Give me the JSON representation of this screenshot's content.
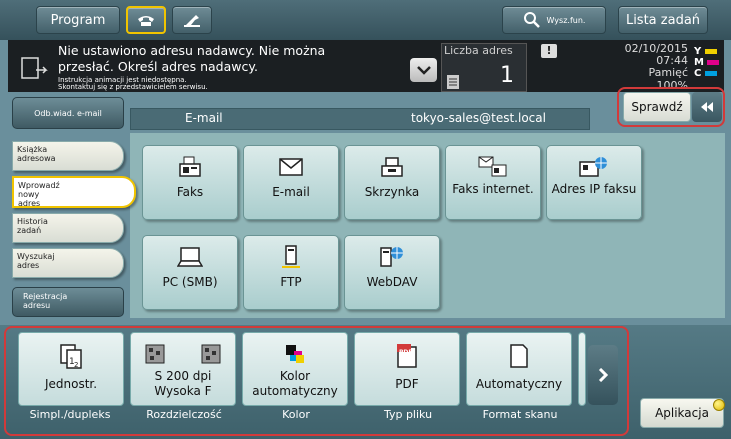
{
  "top": {
    "program": "Program",
    "search": "Wysz.fun.",
    "job_list": "Lista zadań"
  },
  "info": {
    "line1": "Nie ustawiono adresu nadawcy. Nie można",
    "line2": "przesłać. Określ adres nadawcy.",
    "line3": "Instrukcja animacji jest niedostępna.",
    "line4": "Skontaktuj się z przedstawicielem serwisu.",
    "count_label": "Liczba adres",
    "count_value": "1",
    "date": "02/10/2015",
    "time": "07:44",
    "memory": "Pamięć",
    "memory_pct": "100%",
    "toner": {
      "y": "Y",
      "m": "M",
      "c": "C"
    }
  },
  "recv_tab": "Odb.wiad. e-mail",
  "field": {
    "label": "E-mail",
    "value": "tokyo-sales@test.local"
  },
  "check": "Sprawdź",
  "side": [
    "Książka adresowa",
    "Wprowadź nowy adres",
    "Historia zadań",
    "Wyszukaj adres",
    "Rejestracja adresu"
  ],
  "tiles": [
    "Faks",
    "E-mail",
    "Skrzynka",
    "Faks internet.",
    "Adres IP faksu",
    "PC (SMB)",
    "FTP",
    "WebDAV"
  ],
  "bottom": [
    {
      "value": "Jednostr.",
      "label": "Simpl./dupleks"
    },
    {
      "value": "S 200 dpi Wysoka F",
      "label": "Rozdzielczość"
    },
    {
      "value": "Kolor automatyczny",
      "label": "Kolor"
    },
    {
      "value": "PDF",
      "label": "Typ pliku"
    },
    {
      "value": "Automatyczny",
      "label": "Format skanu"
    }
  ],
  "pdf_badge": "PDF",
  "apps": "Aplikacja",
  "colors": {
    "accent": "#f0c400",
    "highlight": "#d23a3a",
    "tile": "#b8d6d6"
  }
}
